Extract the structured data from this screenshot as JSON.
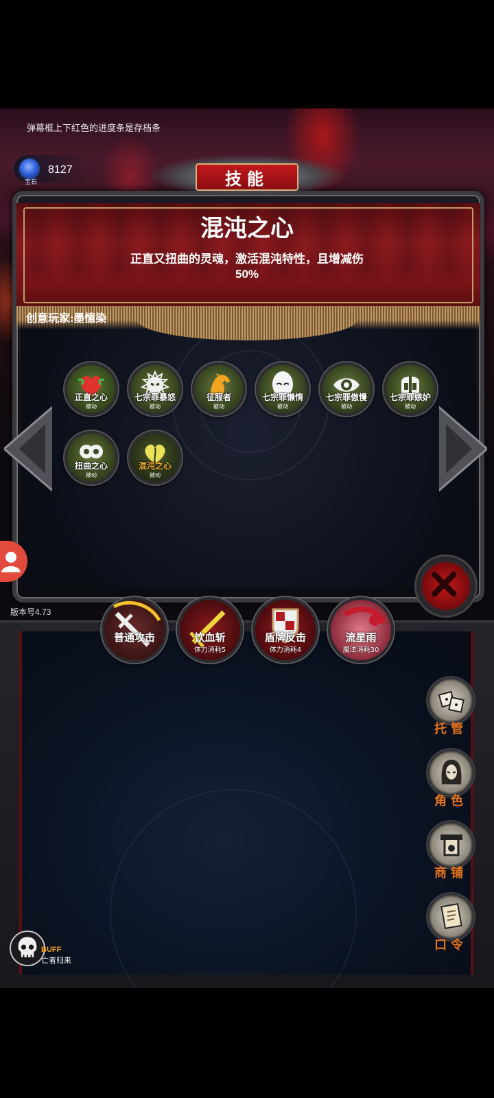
{
  "hint_text": "弹幕框上下红色的进度条是存档条",
  "gems": {
    "count": "8127",
    "caption": "宝石"
  },
  "panel": {
    "header": "技能",
    "skill_title": "混沌之心",
    "skill_description": "正直又扭曲的灵魂，激活混沌特性，且增减伤50%",
    "creator": "创意玩家:墨憶染"
  },
  "skills": [
    {
      "name": "正直之心",
      "tag": "被动",
      "icon": "heart-icon",
      "selected": false
    },
    {
      "name": "七宗罪暴怒",
      "tag": "被动",
      "icon": "wrath-icon",
      "selected": false
    },
    {
      "name": "征服者",
      "tag": "被动",
      "icon": "horse-icon",
      "selected": false
    },
    {
      "name": "七宗罪懒惰",
      "tag": "被动",
      "icon": "mask-icon",
      "selected": false
    },
    {
      "name": "七宗罪傲慢",
      "tag": "被动",
      "icon": "eye-icon",
      "selected": false
    },
    {
      "name": "七宗罪嫉妒",
      "tag": "被动",
      "icon": "helmet-icon",
      "selected": false
    },
    {
      "name": "扭曲之心",
      "tag": "被动",
      "icon": "twisted-heart-icon",
      "selected": false
    },
    {
      "name": "混沌之心",
      "tag": "被动",
      "icon": "chaos-heart-icon",
      "selected": true
    }
  ],
  "version": "版本号4.73",
  "actions": [
    {
      "name": "普通攻击",
      "cost": "",
      "icon": "sword-icon",
      "color": "#5a1a1e"
    },
    {
      "name": "饮血斩",
      "cost": "体力消耗5",
      "icon": "blood-sword-icon",
      "color": "#7a1418"
    },
    {
      "name": "盾牌反击",
      "cost": "体力消耗4",
      "icon": "shield-icon",
      "color": "#801218"
    },
    {
      "name": "流星雨",
      "cost": "魔法消耗30",
      "icon": "meteor-icon",
      "color": "#c25a6a"
    }
  ],
  "side_menu": [
    {
      "label": "托管",
      "icon": "dice-icon"
    },
    {
      "label": "角色",
      "icon": "hood-icon"
    },
    {
      "label": "商铺",
      "icon": "shop-icon"
    },
    {
      "label": "口令",
      "icon": "scroll-icon"
    }
  ],
  "buff": {
    "title": "BUFF",
    "name": "亡者归来",
    "icon": "skull-icon"
  }
}
